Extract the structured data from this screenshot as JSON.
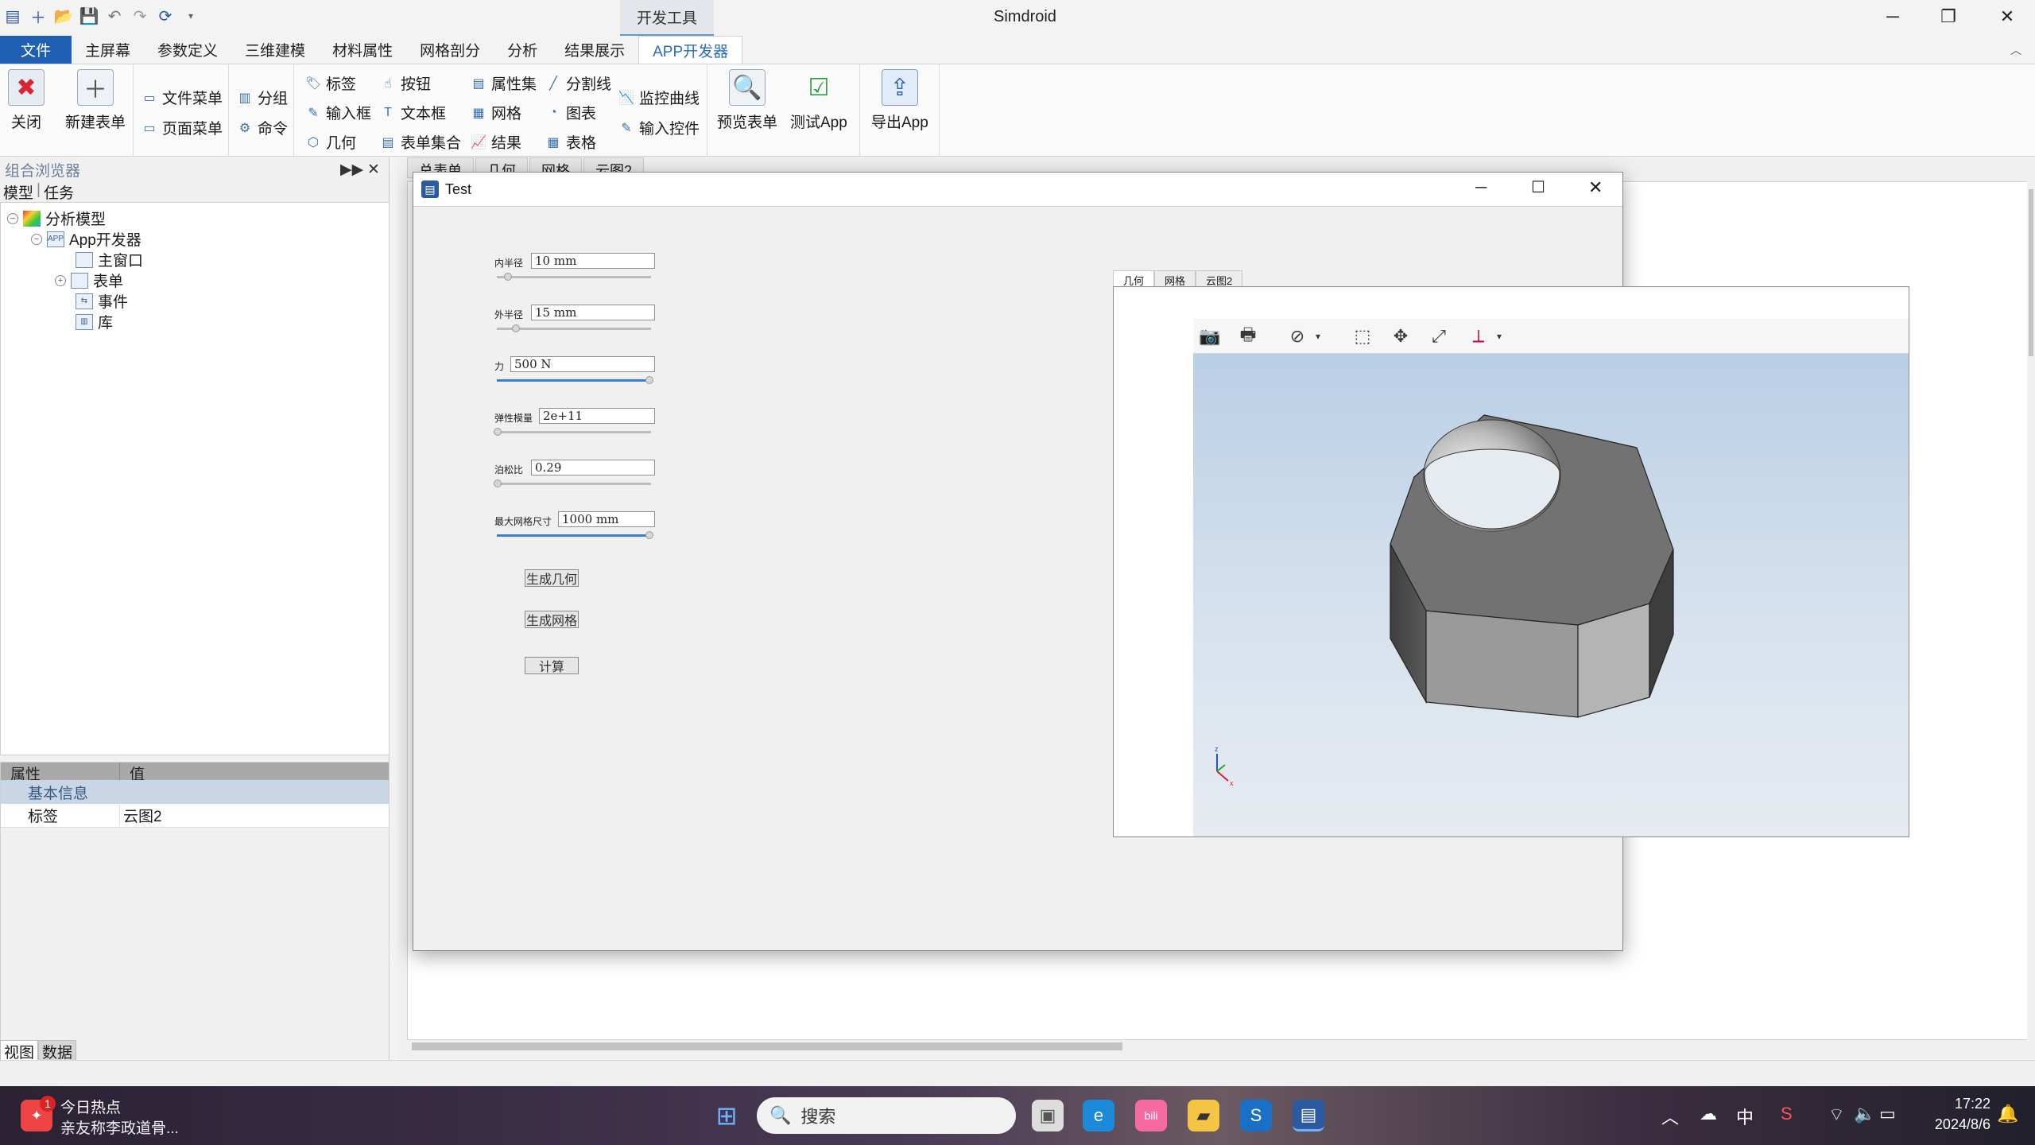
{
  "window": {
    "title": "Simdroid",
    "context_tab": "开发工具"
  },
  "menu": {
    "file": "文件",
    "tabs": [
      "主屏幕",
      "参数定义",
      "三维建模",
      "材料属性",
      "网格剖分",
      "分析",
      "结果展示",
      "APP开发器"
    ],
    "active": "APP开发器"
  },
  "ribbon": {
    "close": "关闭",
    "new_form": "新建表单",
    "file_menu": "文件菜单",
    "page_menu": "页面菜单",
    "group": "分组",
    "command": "命令",
    "label": "标签",
    "input_box": "输入框",
    "geometry": "几何",
    "button": "按钮",
    "textbox": "文本框",
    "form_set": "表单集合",
    "prop_set": "属性集",
    "mesh": "网格",
    "result": "结果",
    "separator": "分割线",
    "chart": "图表",
    "table": "表格",
    "monitor_curve": "监控曲线",
    "input_control": "输入控件",
    "preview_form": "预览表单",
    "test_app": "测试App",
    "export_app": "导出App"
  },
  "left_panel": {
    "title": "组合浏览器",
    "tabs": [
      "模型",
      "任务"
    ],
    "tree": {
      "root": "分析模型",
      "app_dev": "App开发器",
      "app_badge": "APP",
      "main_window": "主窗口",
      "form": "表单",
      "event": "事件",
      "library": "库"
    },
    "props": {
      "col_prop": "属性",
      "col_val": "值",
      "group": "基本信息",
      "row_key": "标签",
      "row_val": "云图2"
    },
    "bottom_tabs": [
      "视图",
      "数据"
    ]
  },
  "doc_tabs": [
    "总表单",
    "几何",
    "网格",
    "云图2"
  ],
  "dialog": {
    "title": "Test",
    "params": [
      {
        "label": "内半径",
        "value": "10 mm",
        "slider": 0.1
      },
      {
        "label": "外半径",
        "value": "15 mm",
        "slider": 0.15
      },
      {
        "label": "力",
        "value": "500 N",
        "slider": 1.0
      },
      {
        "label": "弹性模量",
        "value": "2e+11",
        "slider": 0.0
      },
      {
        "label": "泊松比",
        "value": "0.29",
        "slider": 0.0
      },
      {
        "label": "最大网格尺寸",
        "value": "1000 mm",
        "slider": 1.0
      }
    ],
    "buttons": {
      "gen_geometry": "生成几何",
      "gen_mesh": "生成网格",
      "compute": "计算"
    },
    "view_tabs": [
      "几何",
      "网格",
      "云图2"
    ],
    "active_view_tab": "几何"
  },
  "taskbar": {
    "news_title": "今日热点",
    "news_sub": "亲友称李政道骨...",
    "news_badge": "1",
    "search_placeholder": "搜索",
    "ime": "中",
    "time": "17:22",
    "date": "2024/8/6"
  },
  "colors": {
    "accent": "#1f5fb4",
    "ribbon_active": "#2a6dbd",
    "viewport_top": "#b9cfe6",
    "viewport_bottom": "#e6ebf1",
    "nut_top": "#6e6e6e"
  }
}
